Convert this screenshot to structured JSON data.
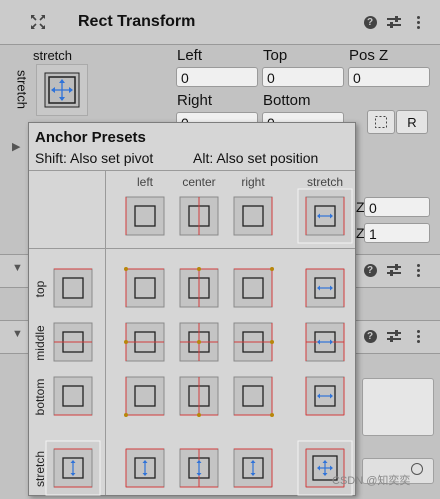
{
  "component": {
    "title": "Rect Transform",
    "anchor_mode_label": "stretch",
    "anchor_mode_vertical": "stretch",
    "fields": {
      "left_label": "Left",
      "left_value": "0",
      "top_label": "Top",
      "top_value": "0",
      "posz_label": "Pos Z",
      "posz_value": "0",
      "right_label": "Right",
      "right_value": "0",
      "bottom_label": "Bottom",
      "bottom_value": "0"
    },
    "raw_button": "R",
    "partial_fields": {
      "z1_label": "Z",
      "z1_value": "0",
      "z2_label": "Z",
      "z2_value": "1"
    }
  },
  "popup": {
    "title": "Anchor Presets",
    "hint_shift": "Shift: Also set pivot",
    "hint_alt": "Alt: Also set position",
    "columns": [
      "left",
      "center",
      "right",
      "stretch"
    ],
    "rows": [
      "top",
      "middle",
      "bottom",
      "stretch"
    ]
  },
  "watermark": "CSDN @知奕奕",
  "colors": {
    "anchor_line": "#d23b3b",
    "arrow_blue": "#2f73d9",
    "panel": "#c2c2c2"
  }
}
